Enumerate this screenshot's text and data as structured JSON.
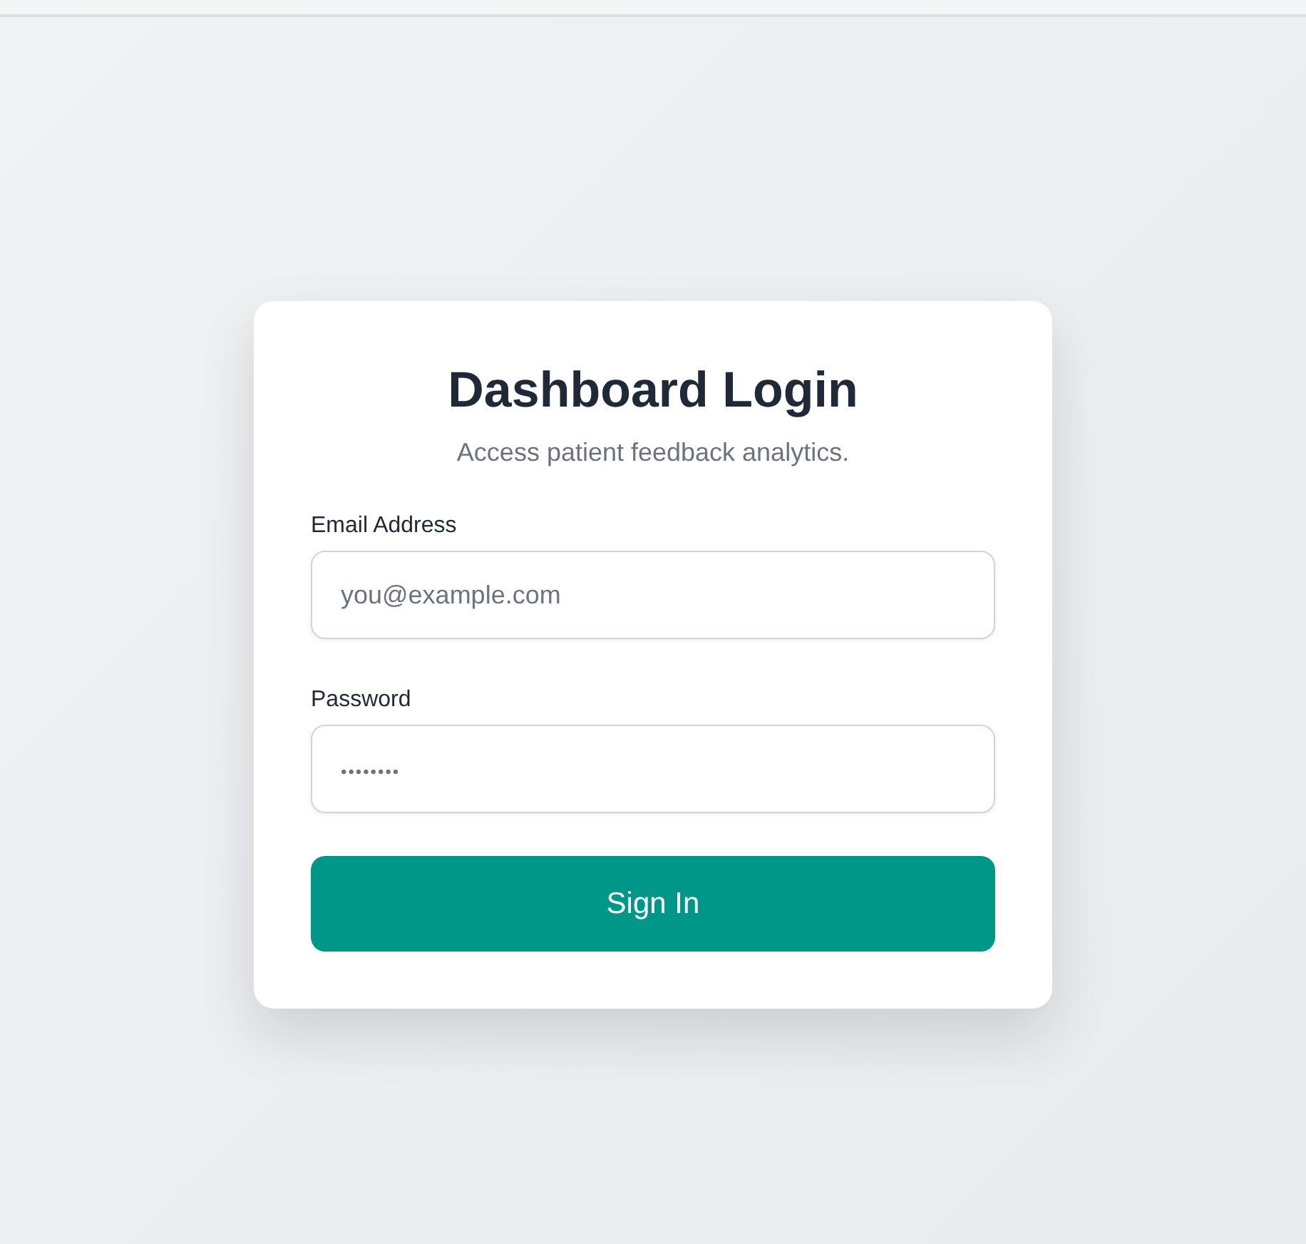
{
  "title": "Dashboard Login",
  "subtitle": "Access patient feedback analytics.",
  "fields": [
    {
      "label": "Email Address",
      "placeholder": "you@example.com",
      "kind": "email"
    },
    {
      "label": "Password",
      "placeholder": "••••••••",
      "kind": "password"
    }
  ],
  "button": "Sign In"
}
